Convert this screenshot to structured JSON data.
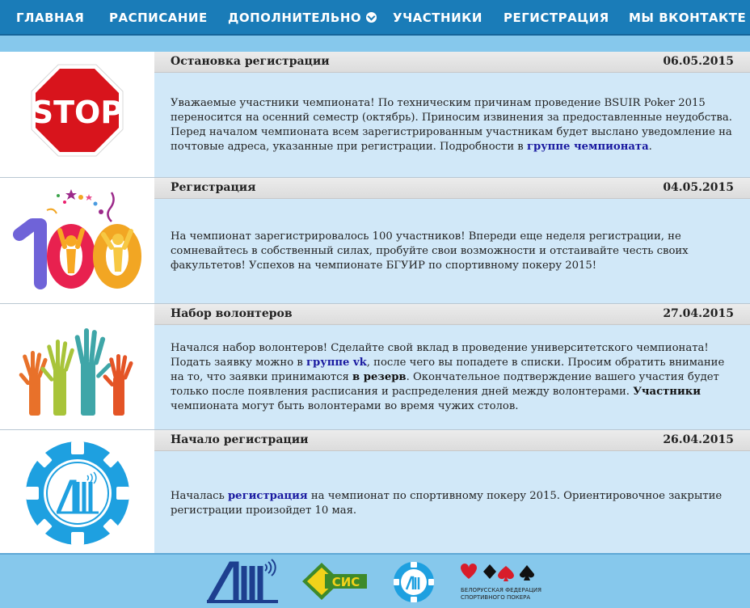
{
  "nav": {
    "items": [
      {
        "label": "ГЛАВНАЯ"
      },
      {
        "label": "РАСПИСАНИЕ"
      },
      {
        "label": "ДОПОЛНИТЕЛЬНО"
      },
      {
        "label": "УЧАСТНИКИ"
      },
      {
        "label": "РЕГИСТРАЦИЯ"
      },
      {
        "label": "МЫ ВКОНТАКТЕ"
      }
    ]
  },
  "news": [
    {
      "title": "Остановка регистрации",
      "date": "06.05.2015",
      "icon": "stop-sign-icon",
      "stop_text": "STOP",
      "t1": "Уважаемые участники чемпионата! По техническим причинам проведение BSUIR Poker 2015 переносится на осенний семестр (октябрь). Приносим извинения за предоставленные неудобства. Перед началом чемпионата всем зарегистрированным участникам будет выслано уведомление на почтовые адреса, указанные при регистрации. Подробности в ",
      "link1": "группе чемпионата",
      "t2": "."
    },
    {
      "title": "Регистрация",
      "date": "04.05.2015",
      "icon": "hundred-celebration-icon",
      "text": "На чемпионат зарегистрировалось 100 участников! Впереди еще неделя регистрации, не сомневайтесь в собственный силах, пробуйте свои возможности и отстаивайте честь своих факультетов! Успехов на чемпионате БГУИР по спортивному покеру 2015!"
    },
    {
      "title": "Набор волонтеров",
      "date": "27.04.2015",
      "icon": "raised-hands-icon",
      "t1": "Начался набор волонтеров! Сделайте свой вклад в проведение университетского чемпионата! Подать заявку можно в ",
      "link1": "группе vk",
      "t2": ", после чего вы попадете в списки. Просим обратить внимание на то, что заявки принимаются ",
      "b1": "в резерв",
      "t3": ". Окончательное подтверждение вашего участия будет только после появления расписания и распределения дней между волонтерами. ",
      "b2": "Участники",
      "t4": " чемпионата могут быть волонтерами во время чужих столов."
    },
    {
      "title": "Начало регистрации",
      "date": "26.04.2015",
      "icon": "poker-chip-logo-icon",
      "t1": "Началась ",
      "link1": "регистрация",
      "t2": " на чемпионат по спортивному покеру 2015. Ориентировочное закрытие регистрации произойдет 10 мая."
    }
  ],
  "footer": {
    "logos": [
      "bsuir-logo-icon",
      "sis-logo-icon",
      "poker-chip-logo-icon",
      "belarus-poker-federation-logo-icon"
    ],
    "sis_text": "СИС",
    "federation_line1": "БЕЛОРУССКАЯ ФЕДЕРАЦИЯ",
    "federation_line2": "СПОРТИВНОГО ПОКЕРА"
  },
  "colors": {
    "nav_bg": "#1a7cb8",
    "page_bg": "#86c8ec",
    "content_bg": "#d1e8f8",
    "link": "#1a1aa0",
    "chip_blue": "#1ea0e0",
    "stop_red": "#d8141c"
  }
}
